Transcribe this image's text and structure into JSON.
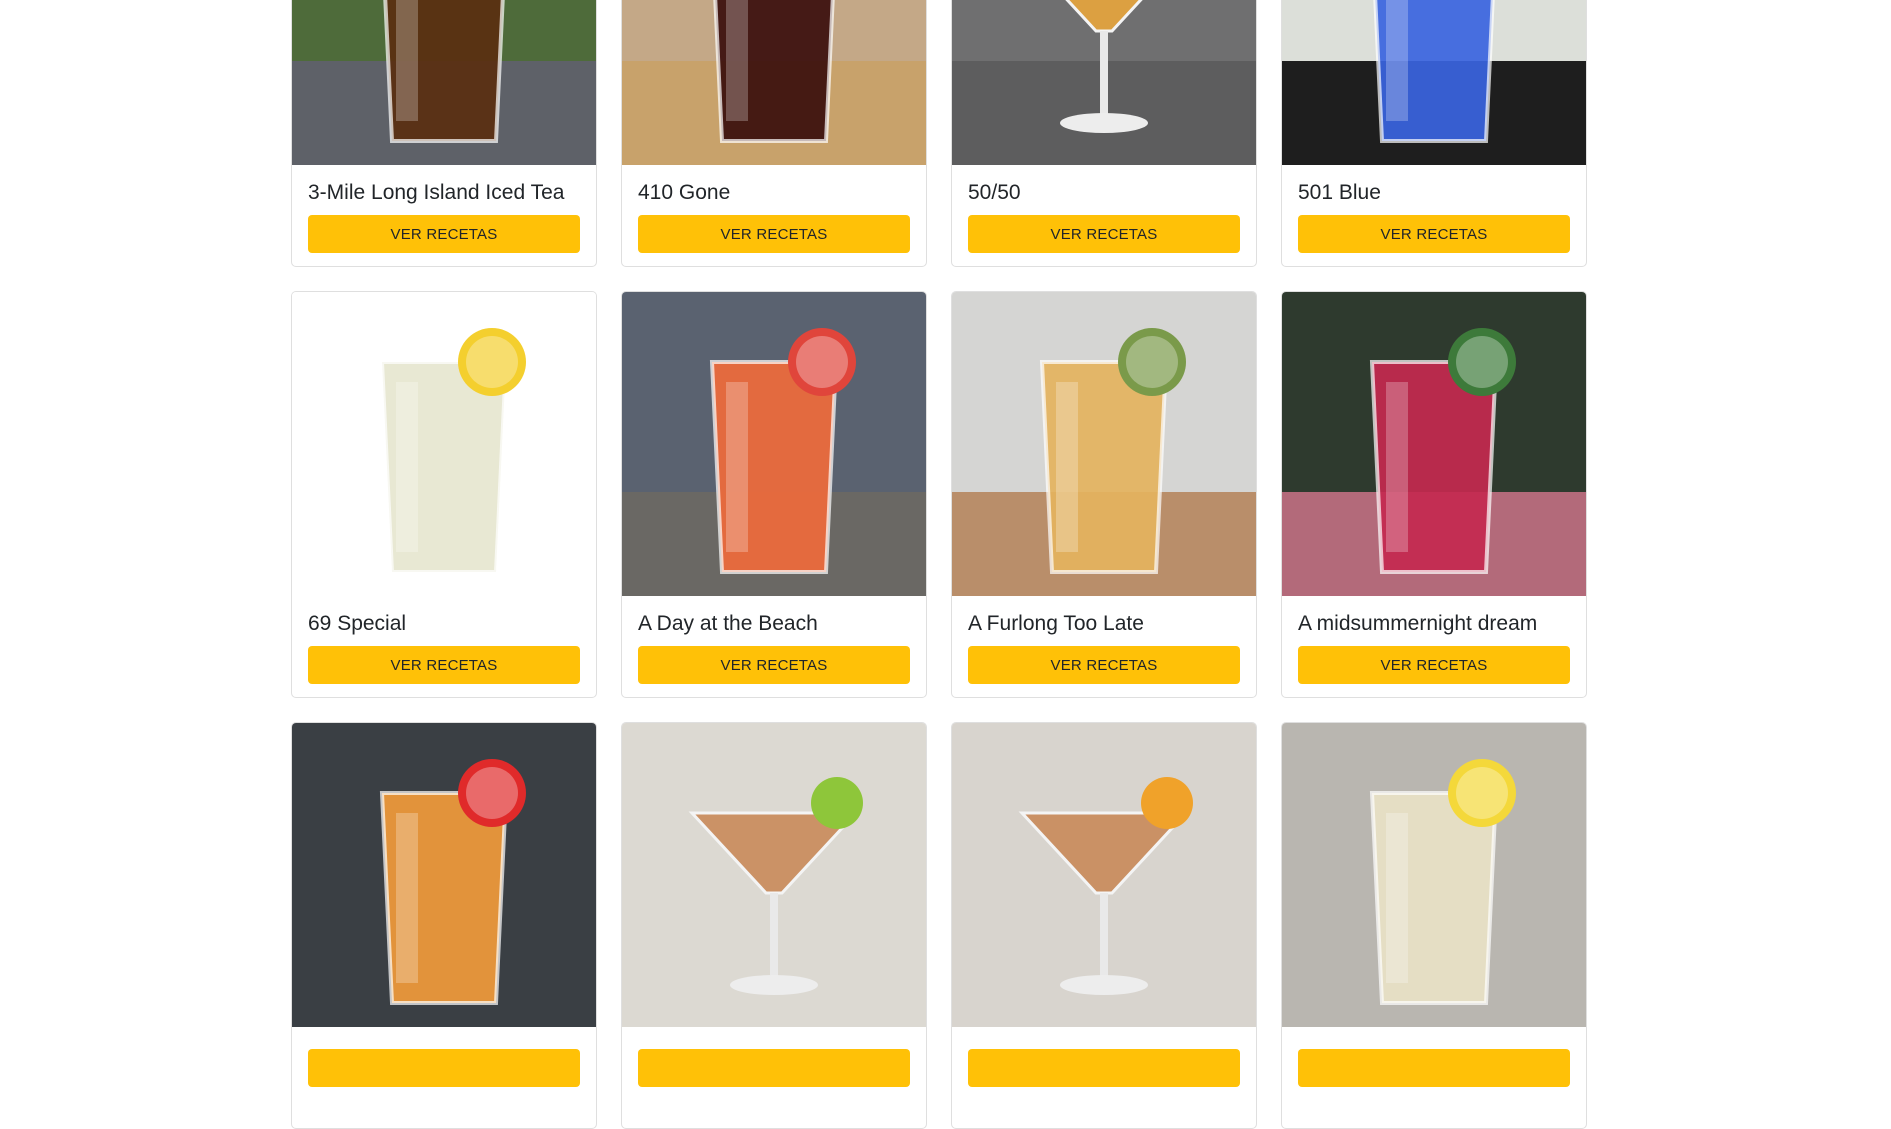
{
  "cards": [
    {
      "name": "3-Mile Long Island Iced Tea",
      "button_label": "VER RECETAS",
      "image_icon": "iced-tea-highball-photo",
      "bg": "#4e6b3a",
      "table": "#5e6168",
      "drink": "#5a2f10",
      "garnish": "#f2d33b",
      "glass": "tumbler"
    },
    {
      "name": "410 Gone",
      "button_label": "VER RECETAS",
      "image_icon": "dark-cocktail-rocks-photo",
      "bg": "#c4a887",
      "table": "#c8a26b",
      "drink": "#3a0e0c",
      "garnish": "#e0463b",
      "glass": "tumbler"
    },
    {
      "name": "50/50",
      "button_label": "VER RECETAS",
      "image_icon": "martini-glass-photo",
      "bg": "#6f6f70",
      "table": "#5d5d5e",
      "drink": "#e8a53c",
      "garnish": "#ef8a3a",
      "glass": "martini"
    },
    {
      "name": "501 Blue",
      "button_label": "VER RECETAS",
      "image_icon": "blue-cocktail-highball-photo",
      "bg": "#dcdfd9",
      "table": "#1e1e1e",
      "drink": "#3a64e0",
      "garnish": "#6b5a78",
      "glass": "tumbler"
    },
    {
      "name": "69 Special",
      "button_label": "VER RECETAS",
      "image_icon": "lemon-cocktail-rocks-photo",
      "bg": "#ffffff",
      "table": "#ffffff",
      "drink": "#e6e6cf",
      "garnish": "#f4cf2e",
      "glass": "tumbler"
    },
    {
      "name": "A Day at the Beach",
      "button_label": "VER RECETAS",
      "image_icon": "sunrise-cocktail-photo",
      "bg": "#5a6270",
      "table": "#6a6864",
      "drink": "#ef6a3b",
      "garnish": "#e0453b",
      "glass": "tumbler"
    },
    {
      "name": "A Furlong Too Late",
      "button_label": "VER RECETAS",
      "image_icon": "ginger-highball-photo",
      "bg": "#d5d5d3",
      "table": "#b98e6a",
      "drink": "#e4b35e",
      "garnish": "#7a9a4a",
      "glass": "tumbler"
    },
    {
      "name": "A midsummernight dream",
      "button_label": "VER RECETAS",
      "image_icon": "berry-cocktail-photo",
      "bg": "#2e3a2e",
      "table": "#b36a7a",
      "drink": "#c4294f",
      "garnish": "#3d7a3a",
      "glass": "tumbler"
    },
    {
      "name": "",
      "button_label": "",
      "image_icon": "orange-cocktail-photo",
      "bg": "#3a3f44",
      "table": "#3a3f44",
      "drink": "#f19a3b",
      "garnish": "#e02a2a",
      "glass": "tumbler"
    },
    {
      "name": "",
      "button_label": "",
      "image_icon": "lime-martini-photo",
      "bg": "#dcd9d2",
      "table": "#dcd9d2",
      "drink": "#c98a5a",
      "garnish": "#8ec63a",
      "glass": "martini"
    },
    {
      "name": "",
      "button_label": "",
      "image_icon": "orange-martini-photo",
      "bg": "#d8d4ce",
      "table": "#d8d4ce",
      "drink": "#c98a5a",
      "garnish": "#f0a22a",
      "glass": "martini"
    },
    {
      "name": "",
      "button_label": "",
      "image_icon": "lemon-iced-drink-photo",
      "bg": "#b9b6b0",
      "table": "#b9b6b0",
      "drink": "#e8e2c6",
      "garnish": "#f4d83a",
      "glass": "tumbler"
    }
  ]
}
